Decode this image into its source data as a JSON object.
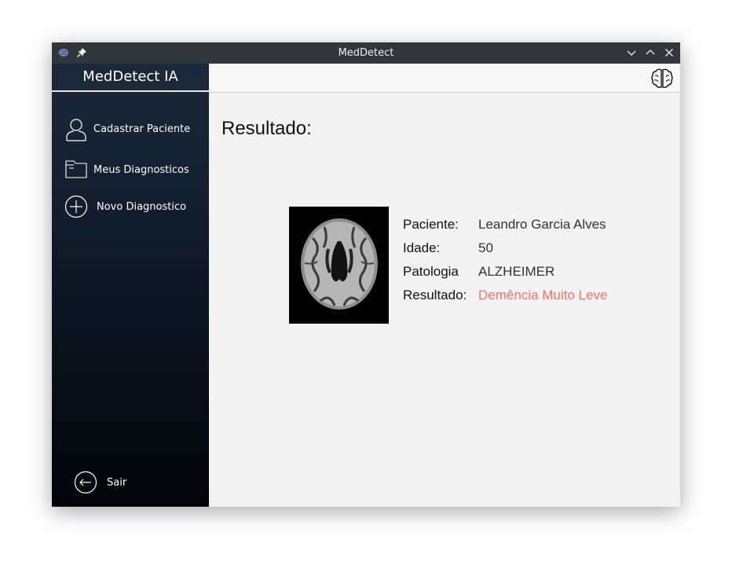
{
  "window": {
    "title": "MedDetect"
  },
  "sidebar": {
    "brand": "MedDetect IA",
    "items": [
      {
        "label": "Cadastrar Paciente",
        "icon": "user-icon"
      },
      {
        "label": "Meus Diagnosticos",
        "icon": "folder-icon"
      },
      {
        "label": "Novo Diagnostico",
        "icon": "plus-circle-icon"
      }
    ],
    "logout": {
      "label": "Sair",
      "icon": "arrow-left-circle-icon"
    }
  },
  "main": {
    "heading": "Resultado:",
    "result": {
      "labels": {
        "patient": "Paciente:",
        "age": "Idade:",
        "pathology": "Patologia",
        "result": "Resultado:"
      },
      "values": {
        "patient": "Leandro Garcia Alves",
        "age": "50",
        "pathology": "ALZHEIMER",
        "result": "Demência Muito Leve"
      }
    }
  },
  "colors": {
    "sidebar_top": "#1b2a3a",
    "sidebar_bottom": "#020409",
    "titlebar": "#31363b",
    "result_text": "#f07070"
  }
}
